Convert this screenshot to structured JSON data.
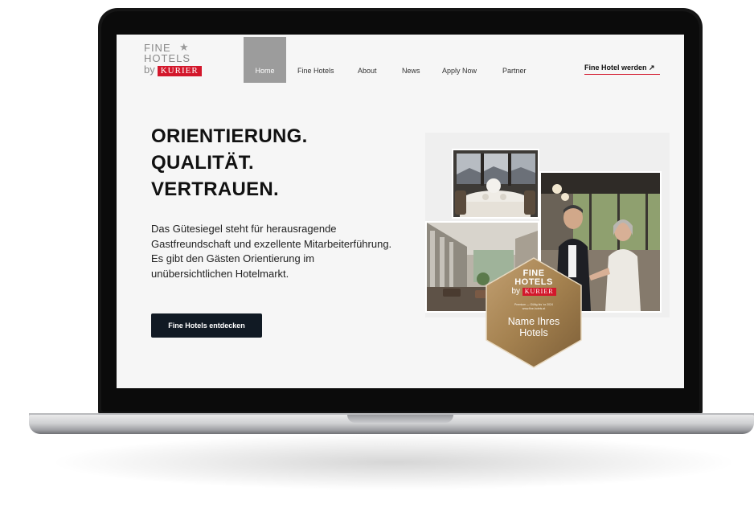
{
  "logo": {
    "line1": "FINE",
    "line2": "HOTELS",
    "by": "by",
    "kurier": "KURIER"
  },
  "nav": {
    "items": [
      "Home",
      "Fine Hotels",
      "About",
      "News",
      "Apply Now",
      "Partner"
    ],
    "cta": "Fine Hotel werden ↗"
  },
  "hero": {
    "headline": [
      "ORIENTIERUNG.",
      "QUALITÄT.",
      "VERTRAUEN."
    ],
    "body": "Das Gütesiegel steht für herausragende Gastfreundschaft und exzellente Mitarbeiterführung. Es gibt den Gästen Orientierung im unübersichtlichen Hotelmarkt.",
    "button": "Fine Hotels entdecken"
  },
  "seal": {
    "line1": "FINE",
    "line2": "HOTELS",
    "by": "by",
    "kurier": "KURIER",
    "small1": "Premium — Gültig bis 'xx 2024",
    "small2": "www.fine-hotels.at",
    "name1": "Name Ihres",
    "name2": "Hotels"
  },
  "colors": {
    "accent": "#d3172b",
    "dark_button": "#111a24",
    "nav_active": "#9c9c9c",
    "seal_gold": "#a8875a"
  },
  "icons": {
    "logo_star": "star-icon",
    "cta_arrow": "arrow-up-right-icon"
  }
}
